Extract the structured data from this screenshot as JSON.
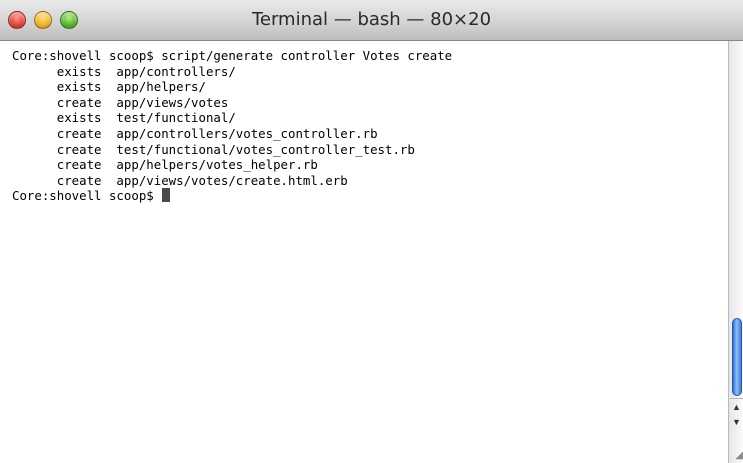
{
  "window": {
    "title": "Terminal — bash — 80×20"
  },
  "terminal": {
    "lines": [
      "Core:shovell scoop$ script/generate controller Votes create",
      "      exists  app/controllers/",
      "      exists  app/helpers/",
      "      create  app/views/votes",
      "      exists  test/functional/",
      "      create  app/controllers/votes_controller.rb",
      "      create  test/functional/votes_controller_test.rb",
      "      create  app/helpers/votes_helper.rb",
      "      create  app/views/votes/create.html.erb"
    ],
    "prompt": "Core:shovell scoop$ "
  },
  "icons": {
    "close": "close-icon",
    "minimize": "minimize-icon",
    "zoom": "zoom-icon",
    "scroll_up": "arrow-up-icon",
    "scroll_down": "arrow-down-icon",
    "resize": "resize-grip-icon"
  }
}
